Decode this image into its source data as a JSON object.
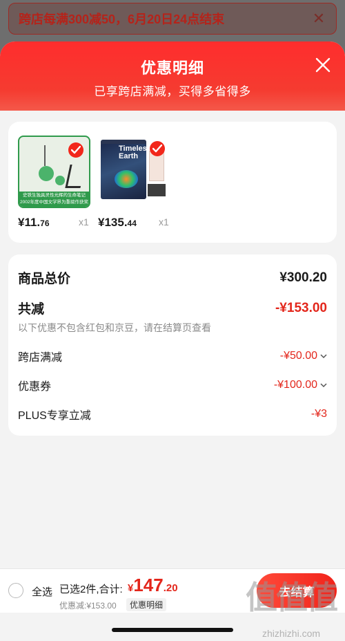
{
  "background_banner": {
    "text": "跨店每满300减50，6月20日24点结束",
    "close_icon": "close-icon"
  },
  "sheet": {
    "title": "优惠明细",
    "subtitle": "已享跨店满减，买得多省得多",
    "close_icon": "close-icon"
  },
  "products": [
    {
      "price_int": "¥11.",
      "price_dec": "76",
      "qty": "x1",
      "selected": true,
      "cover_band": "史铁生独具灵性光辉的生命笔记 2002年度中国文学界为重磅作获奖"
    },
    {
      "price_int": "¥135.",
      "price_dec": "44",
      "qty": "x1",
      "selected": true,
      "cover_text": "Timeless Earth"
    }
  ],
  "summary": {
    "total_label": "商品总价",
    "total_value": "¥300.20",
    "reduce_label": "共减",
    "reduce_value": "-¥153.00",
    "note": "以下优惠不包含红包和京豆，请在结算页查看",
    "items": [
      {
        "label": "跨店满减",
        "value": "-¥50.00"
      },
      {
        "label": "优惠券",
        "value": "-¥100.00"
      },
      {
        "label": "PLUS专享立减",
        "value": "-¥3"
      }
    ]
  },
  "bottom_bar": {
    "select_all": "全选",
    "selected_info": "已选2件,合计:",
    "currency": "¥",
    "total_int": "147",
    "total_dec": ".20",
    "discount_info": "优惠减:¥153.00",
    "detail_tag": "优惠明细",
    "checkout": "去结算"
  },
  "watermark": {
    "logo": "值值值",
    "url": "zhizhizhi.com"
  },
  "colors": {
    "accent": "#f2271b",
    "discount_text": "#e3261b",
    "header_gradient_top": "#ff2d2d"
  }
}
